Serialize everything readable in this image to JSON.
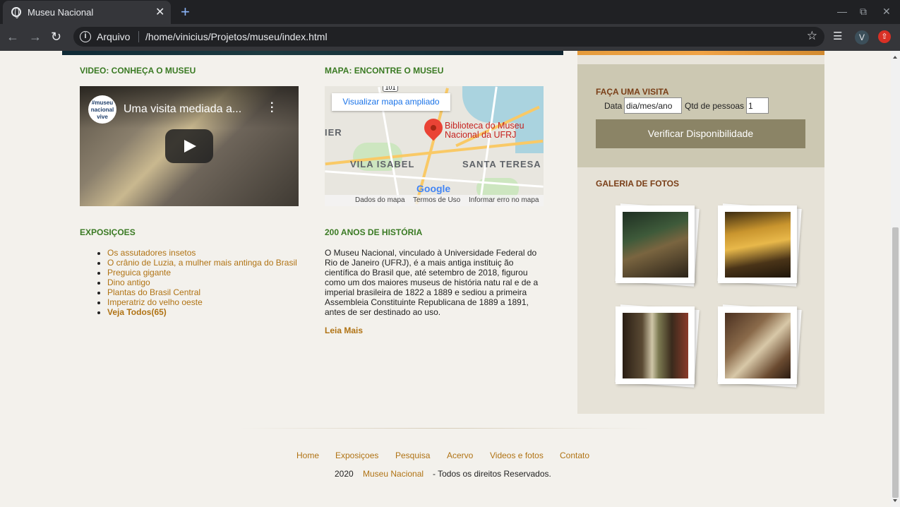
{
  "browser": {
    "tab_title": "Museu Nacional",
    "tab_close": "✕",
    "new_tab": "+",
    "url_label": "Arquivo",
    "url": "/home/vinicius/Projetos/museu/index.html",
    "profile_initial": "V",
    "icons": [
      "globe-icon",
      "back-icon",
      "forward-icon",
      "reload-icon",
      "info-icon",
      "star-icon",
      "media-queue-icon",
      "update-icon"
    ]
  },
  "video_section": {
    "title": "VIDEO: CONHEÇA O MUSEU",
    "video_title": "Uma visita mediada a...",
    "channel_logo": "#museu nacional vive"
  },
  "map_section": {
    "title": "MAPA: ENCONTRE O MUSEU",
    "expand_link": "Visualizar mapa ampliado",
    "place_name_line1": "Biblioteca do Museu",
    "place_name_line2": "Nacional da UFRJ",
    "labels": [
      "VILA ISABEL",
      "SANTA TERESA",
      "IER"
    ],
    "route_number": "101",
    "brand": "Google",
    "footer": [
      "Dados do mapa",
      "Termos de Uso",
      "Informar erro no mapa"
    ]
  },
  "exhibitions": {
    "title": "EXPOSIÇOES",
    "items": [
      "Os assutadores insetos",
      "O crânio de Luzia, a mulher mais antinga do Brasil",
      "Preguica gigante",
      "Dino antigo",
      "Plantas do Brasil Central",
      "Imperatriz do velho oeste"
    ],
    "see_all": "Veja Todos(65)"
  },
  "history": {
    "title": "200 ANOS DE HISTÓRIA",
    "text": "O Museu Nacional, vinculado à Universidade Federal do Rio de Janeiro (UFRJ), é a mais antiga instituiç ão científica do Brasil que, até setembro de 2018, figurou como um dos maiores museus de história natu ral e de a imperial brasileira de 1822 a 1889 e sediou a primeira Assembleia Constituinte Republicana de 1889 a 1891, antes de ser destinado ao uso.",
    "read_more": "Leia Mais"
  },
  "visit": {
    "title": "FAÇA UMA VISITA",
    "date_label": "Data",
    "date_value": "dia/mes/ano",
    "people_label": "Qtd de pessoas",
    "people_value": "1",
    "button": "Verificar Disponibilidade"
  },
  "gallery": {
    "title": "GALERIA DE FOTOS",
    "photos": [
      "photo-exhibit-hall",
      "photo-gallery-room",
      "photo-dress-display",
      "photo-poster-room"
    ]
  },
  "footer": {
    "nav": [
      "Home",
      "Exposiçoes",
      "Pesquisa",
      "Acervo",
      "Videos e fotos",
      "Contato"
    ],
    "year": "2020",
    "site_name": "Museu Nacional",
    "rights": "- Todos os direitos Reservados."
  },
  "colors": {
    "section_title": "#3a7a23",
    "link": "#b07314",
    "sidebar_title": "#7a3f18",
    "visit_bg": "#ccc8b2",
    "button_bg": "#8b8466",
    "gallery_bg": "#e6e2d7"
  }
}
